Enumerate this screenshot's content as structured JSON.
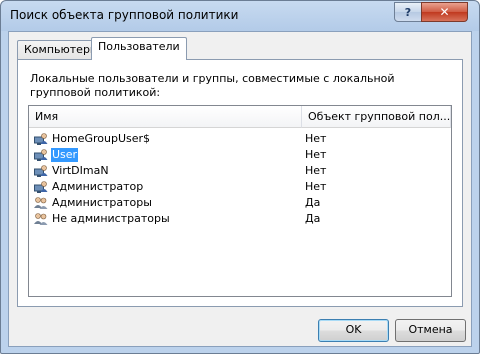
{
  "window": {
    "title": "Поиск объекта групповой политики",
    "help_label": "?",
    "close_label": "✕"
  },
  "tabs": [
    {
      "label": "Компьютеры",
      "active": false
    },
    {
      "label": "Пользователи",
      "active": true
    }
  ],
  "panel": {
    "description": "Локальные пользователи и группы, совместимые с локальной групповой политикой:",
    "columns": [
      "Имя",
      "Объект групповой пол..."
    ],
    "rows": [
      {
        "name": "HomeGroupUser$",
        "value": "Нет",
        "icon": "user-icon",
        "selected": false
      },
      {
        "name": "User",
        "value": "Нет",
        "icon": "user-icon",
        "selected": true
      },
      {
        "name": "VirtDImaN",
        "value": "Нет",
        "icon": "user-icon",
        "selected": false
      },
      {
        "name": "Администратор",
        "value": "Нет",
        "icon": "user-icon",
        "selected": false
      },
      {
        "name": "Администраторы",
        "value": "Да",
        "icon": "group-icon",
        "selected": false
      },
      {
        "name": "Не администраторы",
        "value": "Да",
        "icon": "group-icon",
        "selected": false
      }
    ]
  },
  "buttons": {
    "ok": "OK",
    "cancel": "Отмена"
  },
  "colors": {
    "selection": "#3399ff",
    "title_bar": "#b9d1ea"
  }
}
